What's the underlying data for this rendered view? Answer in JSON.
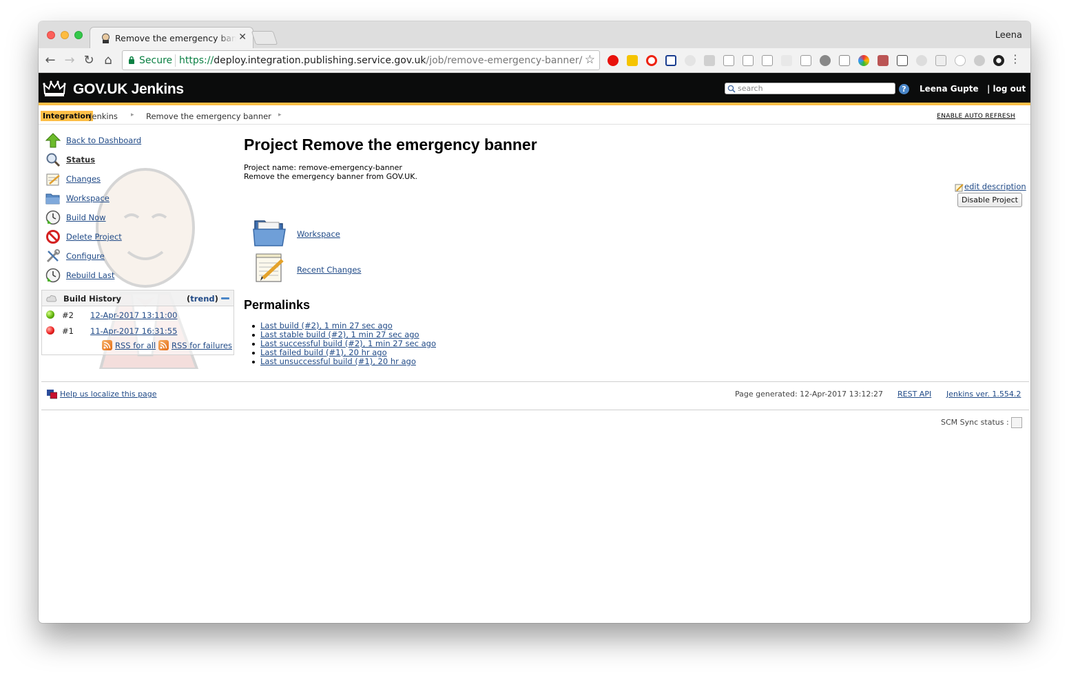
{
  "browser": {
    "tab_title": "Remove the emergency banner",
    "tab_close": "✕",
    "profile_name": "Leena",
    "secure_label": "Secure",
    "url_protocol": "https://",
    "url_host": "deploy.integration.publishing.service.gov.uk",
    "url_path": "/job/remove-emergency-banner/"
  },
  "header": {
    "brand": "GOV.UK Jenkins",
    "search_placeholder": "search",
    "help_glyph": "?",
    "user_name": "Leena Gupte",
    "logout_label": "| log out",
    "accent_color": "#ffbf47"
  },
  "breadcrumbs": {
    "env_badge": "Integration",
    "items": [
      "Jenkins",
      "Remove the emergency banner"
    ],
    "auto_refresh": "ENABLE AUTO REFRESH"
  },
  "sidebar": {
    "tasks": [
      {
        "label": "Back to Dashboard",
        "icon": "up-arrow-icon"
      },
      {
        "label": "Status",
        "icon": "search-icon"
      },
      {
        "label": "Changes",
        "icon": "notepad-icon"
      },
      {
        "label": "Workspace",
        "icon": "folder-icon"
      },
      {
        "label": "Build Now",
        "icon": "clock-icon"
      },
      {
        "label": "Delete Project",
        "icon": "no-entry-icon"
      },
      {
        "label": "Configure",
        "icon": "wrench-icon"
      },
      {
        "label": "Rebuild Last",
        "icon": "clock-icon"
      }
    ],
    "build_history": {
      "title": "Build History",
      "trend_open": "(",
      "trend_label": "trend",
      "trend_close": ")",
      "builds": [
        {
          "number": "#2",
          "date": "12-Apr-2017 13:11:00",
          "status": "success"
        },
        {
          "number": "#1",
          "date": "11-Apr-2017 16:31:55",
          "status": "failed"
        }
      ],
      "rss_all": "RSS for all",
      "rss_failures": "RSS for failures"
    }
  },
  "main": {
    "title": "Project Remove the emergency banner",
    "project_name_line": "Project name: remove-emergency-banner",
    "description": "Remove the emergency banner from GOV.UK.",
    "edit_description": "edit description",
    "disable_button": "Disable Project",
    "links": [
      {
        "label": "Workspace",
        "icon": "folder-icon"
      },
      {
        "label": "Recent Changes",
        "icon": "notepad-icon"
      }
    ],
    "permalinks_heading": "Permalinks",
    "permalinks": [
      "Last build (#2), 1 min 27 sec ago",
      "Last stable build (#2), 1 min 27 sec ago",
      "Last successful build (#2), 1 min 27 sec ago",
      "Last failed build (#1), 20 hr ago",
      "Last unsuccessful build (#1), 20 hr ago"
    ]
  },
  "footer": {
    "localize": "Help us localize this page",
    "page_generated": "Page generated: 12-Apr-2017 13:12:27",
    "rest_api": "REST API",
    "jenkins_version": "Jenkins ver. 1.554.2",
    "scm_sync": "SCM Sync status :"
  }
}
